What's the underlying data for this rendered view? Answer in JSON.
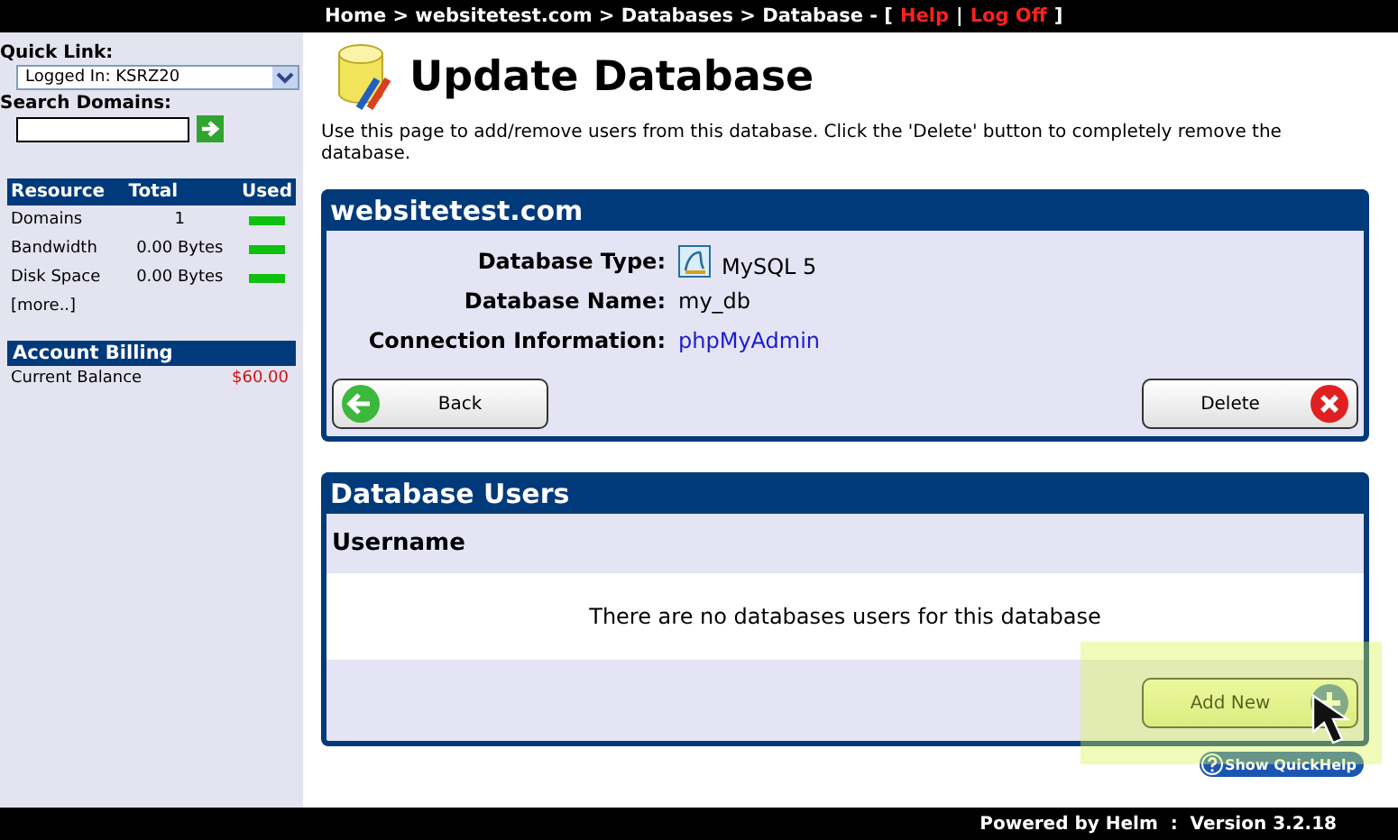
{
  "top_bar": {
    "path": "Home > websitetest.com > Databases > Database - [",
    "links": [
      "Help",
      "Log Off"
    ],
    "link_separator": "|",
    "close": "]"
  },
  "sidebar": {
    "quick_link": {
      "label": "Quick Link:",
      "value": "Logged In: KSRZ20"
    },
    "search": {
      "label": "Search Domains:"
    },
    "resources": {
      "columns": [
        "Resource",
        "Total",
        "Used"
      ],
      "rows": [
        {
          "name": "Domains",
          "total": "1",
          "level": 1
        },
        {
          "name": "Bandwidth",
          "total": "0.00 Bytes",
          "level": 1
        },
        {
          "name": "Disk Space",
          "total": "0.00 Bytes",
          "level": 1
        }
      ],
      "more": "[more..]"
    },
    "billing": {
      "title": "Account Billing",
      "label": "Current Balance",
      "value": "$60.00"
    }
  },
  "page": {
    "title": "Update Database",
    "description": "Use this page to add/remove users from this database. Click the 'Delete' button to completely remove the database."
  },
  "database_panel": {
    "title": "websitetest.com",
    "fields": [
      {
        "label": "Database Type:",
        "value": "MySQL 5",
        "kind": "icon"
      },
      {
        "label": "Database Name:",
        "value": "my_db",
        "kind": "text"
      },
      {
        "label": "Connection Information:",
        "value": "phpMyAdmin",
        "kind": "link"
      }
    ],
    "buttons": [
      "Back",
      "Delete"
    ]
  },
  "users_panel": {
    "title": "Database Users",
    "columns": [
      "Username"
    ],
    "empty_message": "There are no databases users for this database",
    "button": "Add New"
  },
  "quickhelp": "Show QuickHelp",
  "footer": {
    "text": "Powered by Helm  :  Version 3.2.18"
  }
}
